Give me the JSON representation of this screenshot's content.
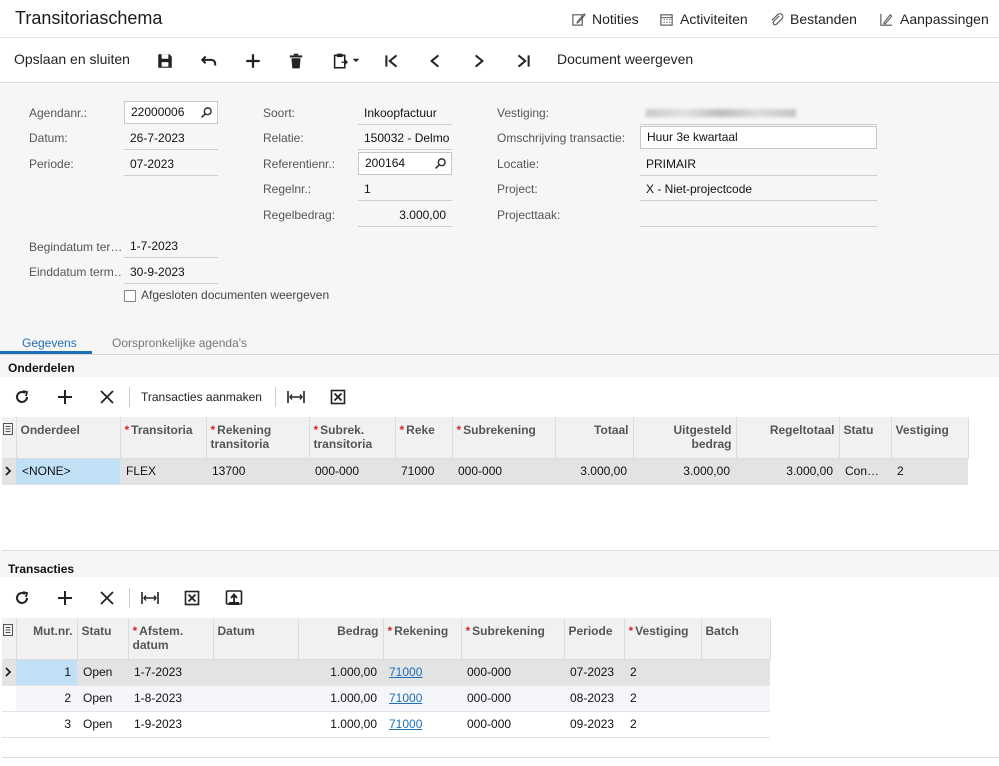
{
  "header": {
    "title": "Transitoriaschema",
    "links": [
      {
        "label": "Notities",
        "icon": "note-edit-icon"
      },
      {
        "label": "Activiteiten",
        "icon": "calendar-icon"
      },
      {
        "label": "Bestanden",
        "icon": "paperclip-icon"
      },
      {
        "label": "Aanpassingen",
        "icon": "customize-icon"
      }
    ]
  },
  "toolbar": {
    "save_close": "Opslaan en sluiten",
    "show_document": "Document weergeven",
    "icons": [
      "save-icon",
      "undo-icon",
      "add-icon",
      "delete-icon",
      "clipboard-icon",
      "first-icon",
      "prev-icon",
      "next-icon",
      "last-icon"
    ]
  },
  "form": {
    "agendanr": {
      "label": "Agendanr.:",
      "value": "22000006"
    },
    "datum": {
      "label": "Datum:",
      "value": "26-7-2023"
    },
    "periode": {
      "label": "Periode:",
      "value": "07-2023"
    },
    "begindatum": {
      "label": "Begindatum ter…",
      "value": "1-7-2023"
    },
    "einddatum": {
      "label": "Einddatum term…",
      "value": "30-9-2023"
    },
    "afgesloten": {
      "label": "Afgesloten documenten weergeven",
      "checked": false
    },
    "soort": {
      "label": "Soort:",
      "value": "Inkoopfactuur"
    },
    "relatie": {
      "label": "Relatie:",
      "value": "150032 - Delmo"
    },
    "referentienr": {
      "label": "Referentienr.:",
      "value": "200164"
    },
    "regelnr": {
      "label": "Regelnr.:",
      "value": "1"
    },
    "regelbedrag": {
      "label": "Regelbedrag:",
      "value": "3.000,00"
    },
    "vestiging": {
      "label": "Vestiging:",
      "value": ""
    },
    "omschrijving": {
      "label": "Omschrijving transactie:",
      "value": "Huur 3e kwartaal"
    },
    "locatie": {
      "label": "Locatie:",
      "value": "PRIMAIR"
    },
    "project": {
      "label": "Project:",
      "value": "X - Niet-projectcode"
    },
    "projecttaak": {
      "label": "Projecttaak:",
      "value": ""
    }
  },
  "tabs": [
    {
      "label": "Gegevens",
      "active": true
    },
    {
      "label": "Oorspronkelijke agenda's",
      "active": false
    }
  ],
  "onderdelen": {
    "title": "Onderdelen",
    "create_label": "Transacties aanmaken",
    "columns": [
      {
        "label": "Onderdeel",
        "req": false
      },
      {
        "label": "Transitoria",
        "req": true
      },
      {
        "label": "Rekening transitoria",
        "req": true
      },
      {
        "label": "Subrek. transitoria",
        "req": true
      },
      {
        "label": "Reke",
        "req": true
      },
      {
        "label": "Subrekening",
        "req": true
      },
      {
        "label": "Totaal",
        "req": false
      },
      {
        "label": "Uitgesteld bedrag",
        "req": false
      },
      {
        "label": "Regeltotaal",
        "req": false
      },
      {
        "label": "Statu",
        "req": false
      },
      {
        "label": "Vestiging",
        "req": false
      }
    ],
    "rows": [
      [
        "<NONE>",
        "FLEX",
        "13700",
        "000-000",
        "71000",
        "000-000",
        "3.000,00",
        "3.000,00",
        "3.000,00",
        "Con…",
        "2"
      ]
    ]
  },
  "transacties": {
    "title": "Transacties",
    "columns": [
      {
        "label": "Mut.nr.",
        "req": false
      },
      {
        "label": "Statu",
        "req": false
      },
      {
        "label": "Afstem. datum",
        "req": true
      },
      {
        "label": "Datum",
        "req": false
      },
      {
        "label": "Bedrag",
        "req": false
      },
      {
        "label": "Rekening",
        "req": true
      },
      {
        "label": "Subrekening",
        "req": true
      },
      {
        "label": "Periode",
        "req": false
      },
      {
        "label": "Vestiging",
        "req": true
      },
      {
        "label": "Batch",
        "req": false
      }
    ],
    "rows": [
      [
        "1",
        "Open",
        "1-7-2023",
        "",
        "1.000,00",
        "71000",
        "000-000",
        "07-2023",
        "2",
        ""
      ],
      [
        "2",
        "Open",
        "1-8-2023",
        "",
        "1.000,00",
        "71000",
        "000-000",
        "08-2023",
        "2",
        ""
      ],
      [
        "3",
        "Open",
        "1-9-2023",
        "",
        "1.000,00",
        "71000",
        "000-000",
        "09-2023",
        "2",
        ""
      ]
    ]
  }
}
